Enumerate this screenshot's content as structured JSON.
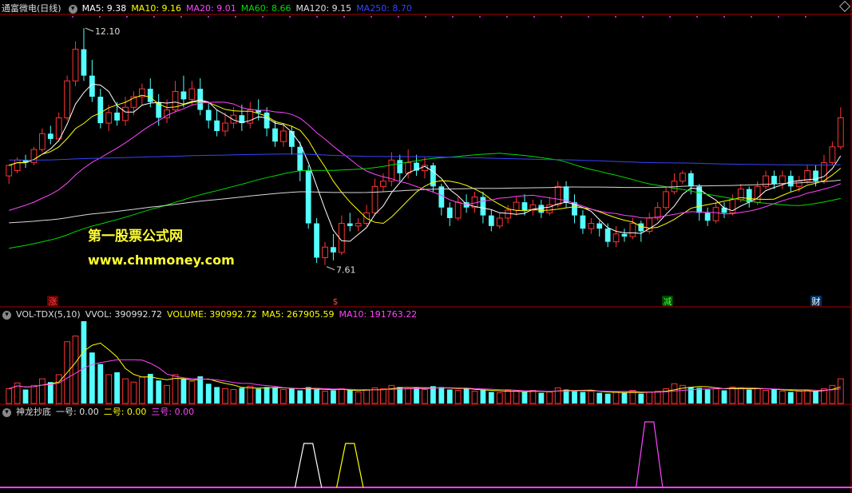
{
  "main_header": {
    "title": "通富微电(日线)",
    "ma": [
      {
        "label": "MA5: 9.38",
        "color": "#ffffff"
      },
      {
        "label": "MA10: 9.16",
        "color": "#ffff00"
      },
      {
        "label": "MA20: 9.01",
        "color": "#ff44ff"
      },
      {
        "label": "MA60: 8.66",
        "color": "#00dd00"
      },
      {
        "label": "MA120: 9.15",
        "color": "#e0e0e0"
      },
      {
        "label": "MA250: 8.70",
        "color": "#3344ff"
      }
    ]
  },
  "vol_header": {
    "title": "VOL-TDX(5,10)",
    "items": [
      {
        "label": "VVOL: 390992.72",
        "color": "#e0e0e0"
      },
      {
        "label": "VOLUME: 390992.72",
        "color": "#ffff00"
      },
      {
        "label": "MA5: 267905.59",
        "color": "#ffff00"
      },
      {
        "label": "MA10: 191763.22",
        "color": "#ff44ff"
      }
    ]
  },
  "ind_header": {
    "title": "神龙抄底",
    "items": [
      {
        "label": "一号: 0.00",
        "color": "#e0e0e0"
      },
      {
        "label": "二号: 0.00",
        "color": "#ffff00"
      },
      {
        "label": "三号: 0.00",
        "color": "#ff44ff"
      }
    ]
  },
  "annotations": {
    "high_label": "12.10",
    "low_label": "7.61",
    "markers": [
      {
        "text": "涨",
        "color": "#ff4444",
        "bg": "#660000"
      },
      {
        "text": "$",
        "color": "#ff4444",
        "bg": "#000000"
      },
      {
        "text": "减",
        "color": "#44ff44",
        "bg": "#004400"
      },
      {
        "text": "财",
        "color": "#ffffff",
        "bg": "#003366"
      }
    ]
  },
  "watermark": {
    "line1": "第一股票公式网",
    "line2": "www.chnmoney.com"
  },
  "colors": {
    "up": "#ff3333",
    "down": "#54ffff",
    "background": "#000000",
    "separator": "#aa0000"
  },
  "chart_data": {
    "type": "candlestick",
    "y_range": [
      7.0,
      12.3
    ],
    "high": 12.1,
    "low": 7.61,
    "candles": [
      [
        9.3,
        9.5,
        9.35,
        9.15
      ],
      [
        9.4,
        9.6,
        9.65,
        9.35
      ],
      [
        9.6,
        9.55,
        9.7,
        9.45
      ],
      [
        9.55,
        9.8,
        9.85,
        9.5
      ],
      [
        9.8,
        10.1,
        10.2,
        9.75
      ],
      [
        10.1,
        10.0,
        10.25,
        9.9
      ],
      [
        10.0,
        10.4,
        10.5,
        9.95
      ],
      [
        10.4,
        11.1,
        11.2,
        10.35
      ],
      [
        11.1,
        11.7,
        11.85,
        11.0
      ],
      [
        11.7,
        11.2,
        12.1,
        11.1
      ],
      [
        11.2,
        10.8,
        11.5,
        10.7
      ],
      [
        10.8,
        10.3,
        10.95,
        10.2
      ],
      [
        10.3,
        10.5,
        10.65,
        10.15
      ],
      [
        10.5,
        10.35,
        10.7,
        10.25
      ],
      [
        10.35,
        10.6,
        10.8,
        10.25
      ],
      [
        10.6,
        10.8,
        10.9,
        10.45
      ],
      [
        10.8,
        10.95,
        11.05,
        10.65
      ],
      [
        10.95,
        10.7,
        11.15,
        10.6
      ],
      [
        10.7,
        10.4,
        10.85,
        10.25
      ],
      [
        10.4,
        10.55,
        10.75,
        10.3
      ],
      [
        10.55,
        10.9,
        11.1,
        10.5
      ],
      [
        10.9,
        10.75,
        11.2,
        10.6
      ],
      [
        10.75,
        10.95,
        11.1,
        10.65
      ],
      [
        10.95,
        10.55,
        11.15,
        10.45
      ],
      [
        10.55,
        10.35,
        10.7,
        10.2
      ],
      [
        10.35,
        10.15,
        10.55,
        10.05
      ],
      [
        10.15,
        10.3,
        10.5,
        10.05
      ],
      [
        10.3,
        10.45,
        10.6,
        10.2
      ],
      [
        10.45,
        10.3,
        10.65,
        10.15
      ],
      [
        10.3,
        10.55,
        10.7,
        10.2
      ],
      [
        10.55,
        10.5,
        10.75,
        10.35
      ],
      [
        10.5,
        10.2,
        10.6,
        10.05
      ],
      [
        10.2,
        9.95,
        10.35,
        9.85
      ],
      [
        9.95,
        10.15,
        10.3,
        9.85
      ],
      [
        10.15,
        9.85,
        10.25,
        9.7
      ],
      [
        9.85,
        9.4,
        9.95,
        9.2
      ],
      [
        9.4,
        8.4,
        9.5,
        8.3
      ],
      [
        8.4,
        7.75,
        8.5,
        7.65
      ],
      [
        7.75,
        7.95,
        8.05,
        7.61
      ],
      [
        7.95,
        7.85,
        8.2,
        7.7
      ],
      [
        7.85,
        8.4,
        8.55,
        7.8
      ],
      [
        8.4,
        8.35,
        8.6,
        8.25
      ],
      [
        8.35,
        8.4,
        8.5,
        8.25
      ],
      [
        8.4,
        8.6,
        8.75,
        8.35
      ],
      [
        8.6,
        9.1,
        9.25,
        8.55
      ],
      [
        9.1,
        9.2,
        9.35,
        9.0
      ],
      [
        9.2,
        9.6,
        9.75,
        9.1
      ],
      [
        9.6,
        9.35,
        9.7,
        9.2
      ],
      [
        9.35,
        9.55,
        9.8,
        9.25
      ],
      [
        9.55,
        9.4,
        9.7,
        9.3
      ],
      [
        9.4,
        9.5,
        9.65,
        9.25
      ],
      [
        9.5,
        9.1,
        9.55,
        9.0
      ],
      [
        9.1,
        8.7,
        9.15,
        8.55
      ],
      [
        8.7,
        8.5,
        8.8,
        8.35
      ],
      [
        8.5,
        8.8,
        8.9,
        8.45
      ],
      [
        8.8,
        8.7,
        8.95,
        8.6
      ],
      [
        8.7,
        8.9,
        9.0,
        8.6
      ],
      [
        8.9,
        8.55,
        9.0,
        8.4
      ],
      [
        8.55,
        8.35,
        8.65,
        8.25
      ],
      [
        8.35,
        8.5,
        8.6,
        8.3
      ],
      [
        8.5,
        8.65,
        8.75,
        8.4
      ],
      [
        8.65,
        8.8,
        8.9,
        8.55
      ],
      [
        8.8,
        8.65,
        8.95,
        8.55
      ],
      [
        8.65,
        8.75,
        8.85,
        8.55
      ],
      [
        8.75,
        8.6,
        8.85,
        8.5
      ],
      [
        8.6,
        8.75,
        8.9,
        8.55
      ],
      [
        8.75,
        9.1,
        9.2,
        8.7
      ],
      [
        9.1,
        8.8,
        9.2,
        8.7
      ],
      [
        8.8,
        8.55,
        8.95,
        8.4
      ],
      [
        8.55,
        8.3,
        8.65,
        8.2
      ],
      [
        8.3,
        8.4,
        8.5,
        8.2
      ],
      [
        8.4,
        8.3,
        8.45,
        8.15
      ],
      [
        8.3,
        8.05,
        8.4,
        7.95
      ],
      [
        8.05,
        8.2,
        8.35,
        7.95
      ],
      [
        8.2,
        8.15,
        8.3,
        8.05
      ],
      [
        8.15,
        8.4,
        8.5,
        8.1
      ],
      [
        8.4,
        8.25,
        8.45,
        8.05
      ],
      [
        8.25,
        8.5,
        8.6,
        8.2
      ],
      [
        8.5,
        8.7,
        8.8,
        8.45
      ],
      [
        8.7,
        9.0,
        9.1,
        8.65
      ],
      [
        9.0,
        9.2,
        9.35,
        8.95
      ],
      [
        9.2,
        9.35,
        9.4,
        9.15
      ],
      [
        9.35,
        9.1,
        9.4,
        8.95
      ],
      [
        9.1,
        8.6,
        9.15,
        8.45
      ],
      [
        8.6,
        8.45,
        8.7,
        8.35
      ],
      [
        8.45,
        8.7,
        8.8,
        8.4
      ],
      [
        8.7,
        8.6,
        8.8,
        8.5
      ],
      [
        8.6,
        8.85,
        8.95,
        8.55
      ],
      [
        8.85,
        9.05,
        9.15,
        8.8
      ],
      [
        9.05,
        8.8,
        9.1,
        8.7
      ],
      [
        8.8,
        9.1,
        9.2,
        8.75
      ],
      [
        9.1,
        9.3,
        9.4,
        9.05
      ],
      [
        9.3,
        9.15,
        9.4,
        9.05
      ],
      [
        9.15,
        9.3,
        9.4,
        9.05
      ],
      [
        9.3,
        9.1,
        9.4,
        9.0
      ],
      [
        9.1,
        9.2,
        9.3,
        9.0
      ],
      [
        9.2,
        9.4,
        9.5,
        9.15
      ],
      [
        9.4,
        9.2,
        9.5,
        9.1
      ],
      [
        9.2,
        9.55,
        9.7,
        9.15
      ],
      [
        9.55,
        9.85,
        9.95,
        9.5
      ],
      [
        9.85,
        10.4,
        10.6,
        9.8
      ]
    ],
    "volume": [
      0.18,
      0.25,
      0.17,
      0.22,
      0.3,
      0.26,
      0.35,
      0.75,
      0.82,
      1.0,
      0.62,
      0.48,
      0.35,
      0.38,
      0.3,
      0.26,
      0.32,
      0.36,
      0.28,
      0.22,
      0.35,
      0.3,
      0.27,
      0.33,
      0.24,
      0.2,
      0.18,
      0.17,
      0.19,
      0.21,
      0.18,
      0.2,
      0.19,
      0.17,
      0.18,
      0.16,
      0.2,
      0.17,
      0.15,
      0.16,
      0.18,
      0.16,
      0.14,
      0.17,
      0.19,
      0.18,
      0.22,
      0.2,
      0.18,
      0.19,
      0.17,
      0.21,
      0.2,
      0.17,
      0.16,
      0.18,
      0.15,
      0.17,
      0.14,
      0.13,
      0.16,
      0.15,
      0.14,
      0.16,
      0.13,
      0.14,
      0.19,
      0.17,
      0.16,
      0.14,
      0.15,
      0.13,
      0.12,
      0.14,
      0.13,
      0.16,
      0.12,
      0.14,
      0.15,
      0.18,
      0.24,
      0.22,
      0.2,
      0.19,
      0.17,
      0.18,
      0.16,
      0.2,
      0.19,
      0.17,
      0.18,
      0.16,
      0.17,
      0.15,
      0.14,
      0.15,
      0.16,
      0.15,
      0.18,
      0.22,
      0.3
    ],
    "signals": [
      {
        "index": 36,
        "series": "一号",
        "color": "#ffffff"
      },
      {
        "index": 41,
        "series": "二号",
        "color": "#ffff00"
      },
      {
        "index": 77,
        "series": "三号",
        "color": "#ff44ff"
      }
    ]
  }
}
